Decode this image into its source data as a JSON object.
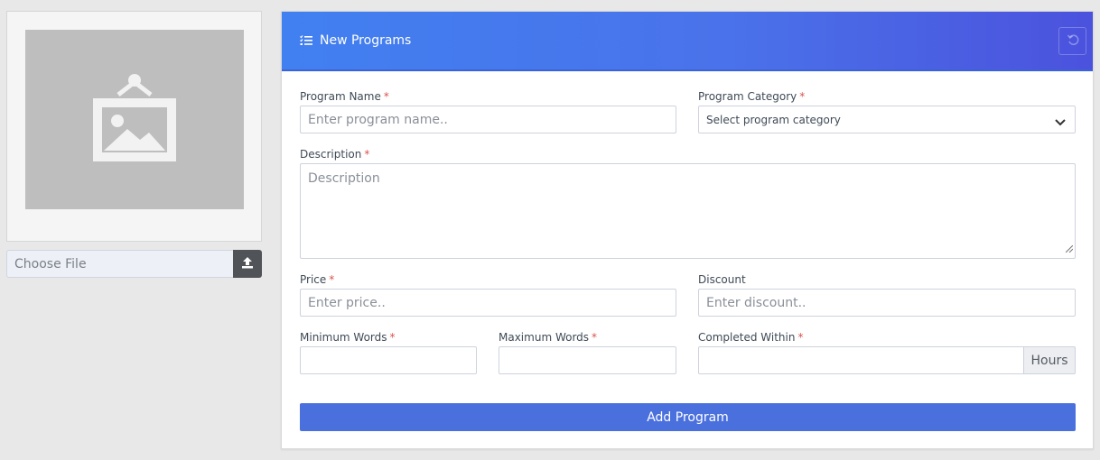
{
  "upload": {
    "choose_file_label": "Choose File",
    "image_icon": "image-placeholder-icon",
    "upload_icon": "upload-icon"
  },
  "card": {
    "title": "New Programs",
    "title_icon": "list-check-icon",
    "reset_icon": "undo-icon"
  },
  "form": {
    "program_name": {
      "label": "Program Name",
      "placeholder": "Enter program name..",
      "required": "*"
    },
    "program_category": {
      "label": "Program Category",
      "selected": "Select program category",
      "required": "*"
    },
    "description": {
      "label": "Description",
      "placeholder": "Description",
      "required": "*"
    },
    "price": {
      "label": "Price",
      "placeholder": "Enter price..",
      "required": "*"
    },
    "discount": {
      "label": "Discount",
      "placeholder": "Enter discount.."
    },
    "minimum_words": {
      "label": "Minimum Words",
      "required": "*"
    },
    "maximum_words": {
      "label": "Maximum Words",
      "required": "*"
    },
    "completed_within": {
      "label": "Completed Within",
      "addon": "Hours",
      "required": "*"
    },
    "submit_label": "Add Program"
  },
  "colors": {
    "header_gradient_start": "#4180f0",
    "header_gradient_end": "#4b52dd",
    "primary_button": "#4a70de",
    "required_marker": "#d9534f"
  }
}
